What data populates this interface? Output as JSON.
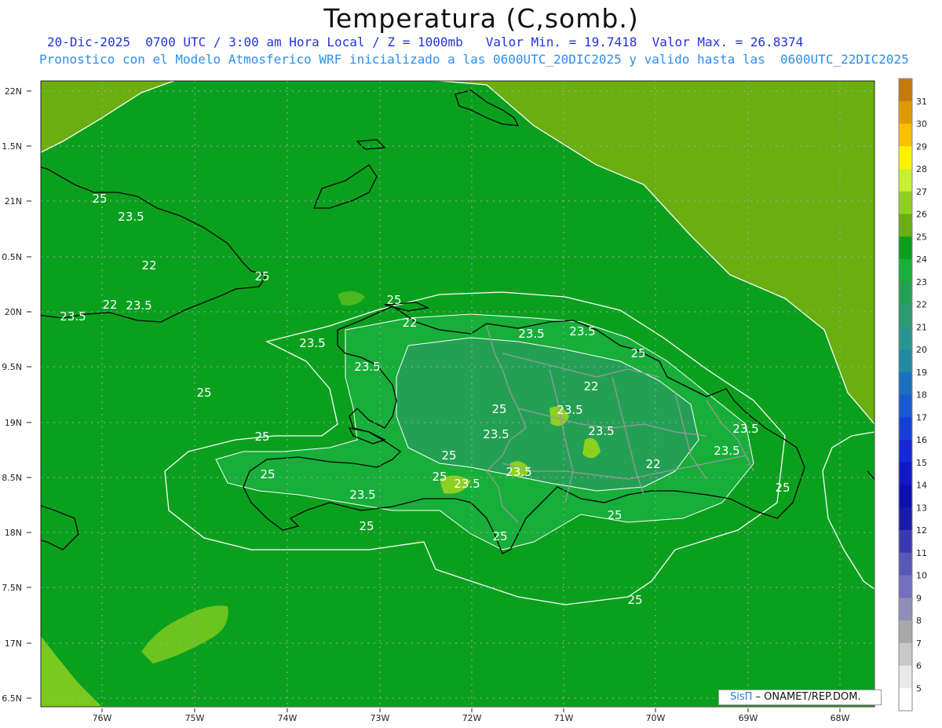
{
  "header": {
    "title": "Temperatura (C,somb.)",
    "subtitle_line1": "20-Dic-2025  0700 UTC / 3:00 am Hora Local / Z = 1000mb   Valor Min. = 19.7418  Valor Max. = 26.8374",
    "subtitle_line2": "Pronostico con el Modelo Atmosferico WRF inicializado a las 0600UTC_20DIC2025 y valido hasta las  0600UTC_22DIC2025"
  },
  "credit": {
    "brand": "SisΠ",
    "text": " – ONAMET/REP.DOM."
  },
  "chart_data": {
    "type": "heatmap",
    "title": "Temperatura (C,somb.)",
    "lon_ticks": [
      "76W",
      "75W",
      "74W",
      "73W",
      "72W",
      "71W",
      "70W",
      "69W",
      "68W"
    ],
    "lat_ticks": [
      "22N",
      "1.5N",
      "21N",
      "0.5N",
      "20N",
      "9.5N",
      "19N",
      "8.5N",
      "18N",
      "7.5N",
      "17N",
      "6.5N"
    ],
    "value_min": 19.7418,
    "value_max": 26.8374,
    "colorbar": {
      "labels": [
        "31",
        "30",
        "29",
        "28",
        "27",
        "26",
        "25",
        "24",
        "23",
        "22",
        "21",
        "20",
        "19",
        "18",
        "17",
        "16",
        "15",
        "14",
        "13",
        "12",
        "11",
        "10",
        "9",
        "8",
        "7",
        "6",
        "5"
      ],
      "colors": [
        "#c47a08",
        "#e09a00",
        "#f8c000",
        "#fff200",
        "#c8f030",
        "#8ed020",
        "#6aae10",
        "#0aa01e",
        "#18ae3a",
        "#24a055",
        "#2a9a70",
        "#2a9590",
        "#218aa0",
        "#1c70c0",
        "#1a5ad0",
        "#1840d8",
        "#1428d8",
        "#1018c8",
        "#0c10b0",
        "#1a1aa8",
        "#3a3ab0",
        "#5858b8",
        "#7470c0",
        "#8e8eb8",
        "#a8a8a8",
        "#c8c8c8",
        "#e8e8e8",
        "#ffffff"
      ]
    },
    "contour_labels": [
      "25",
      "23.5",
      "22",
      "25",
      "22",
      "23.5",
      "23.5",
      "25",
      "23.5",
      "22",
      "23.5",
      "25",
      "25",
      "23.5",
      "25",
      "23.5",
      "22",
      "25",
      "23.5",
      "23.5",
      "23.5",
      "25",
      "25",
      "23.5",
      "23.5",
      "22",
      "23.5",
      "23.5",
      "25",
      "25",
      "23.5",
      "25",
      "25",
      "25",
      "25"
    ]
  }
}
